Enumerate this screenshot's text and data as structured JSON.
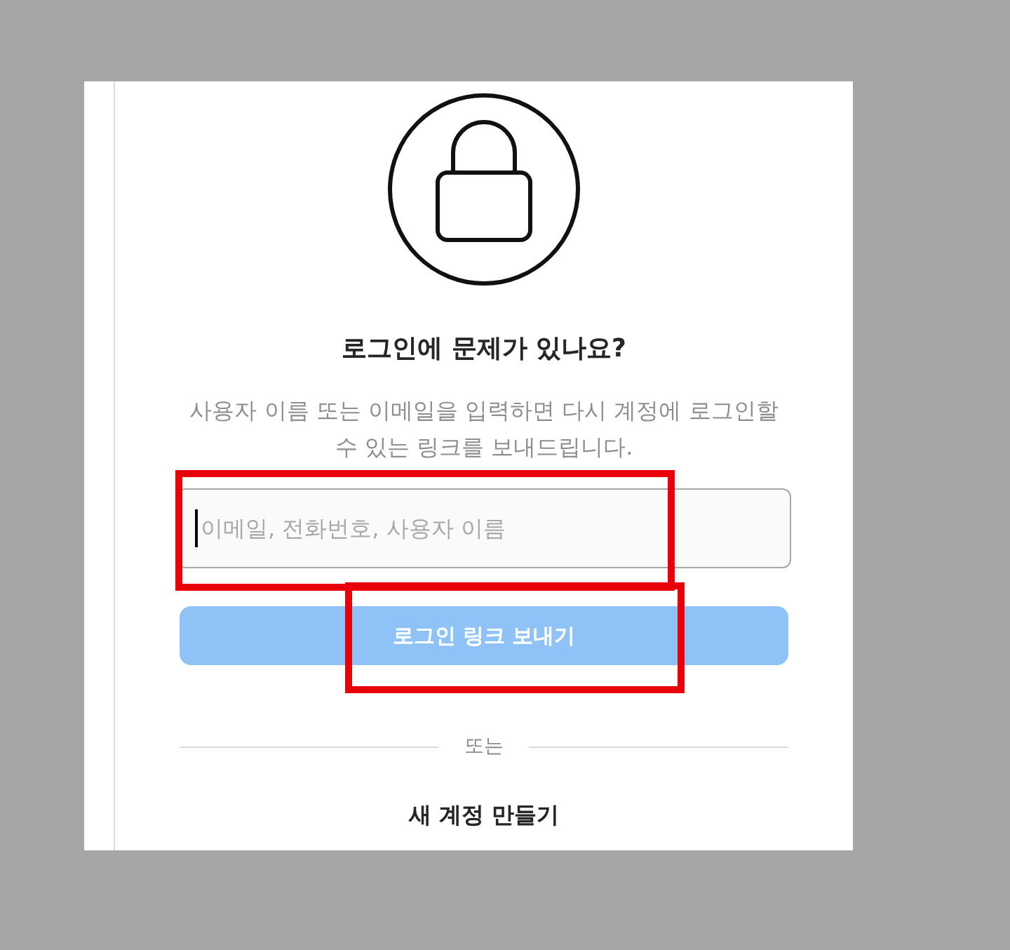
{
  "title": "로그인에 문제가 있나요?",
  "description": "사용자 이름 또는 이메일을 입력하면 다시 계정에 로그인할 수 있는 링크를 보내드립니다.",
  "field": {
    "placeholder": "이메일, 전화번호, 사용자 이름",
    "focused": true
  },
  "send_button": {
    "label": "로그인 링크 보내기",
    "disabled": true
  },
  "divider": "또는",
  "create_account": "새 계정 만들기"
}
